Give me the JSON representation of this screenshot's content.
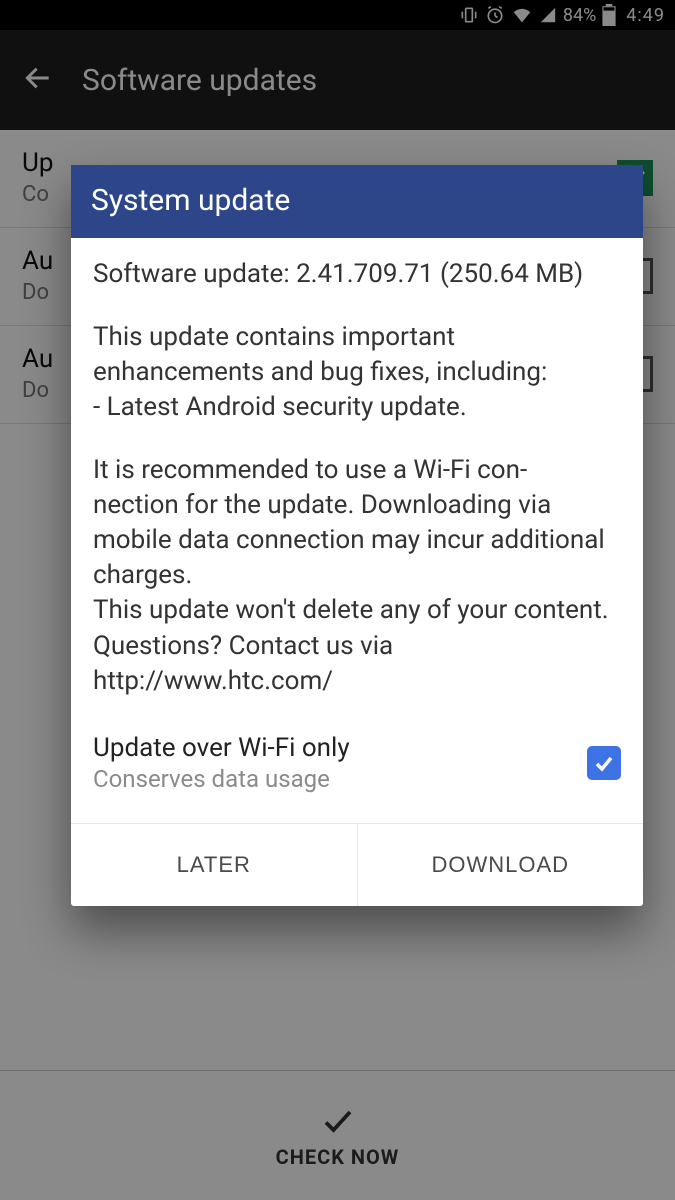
{
  "status": {
    "battery_pct": "84%",
    "time": "4:49"
  },
  "app_bar": {
    "title": "Software updates"
  },
  "bg": {
    "row1_primary": "Up",
    "row1_secondary": "Co",
    "row2_primary": "Au",
    "row2_secondary": "Do",
    "row3_primary": "Au",
    "row3_secondary": "Do",
    "check_now_label": "CHECK NOW"
  },
  "dialog": {
    "title": "System update",
    "version_line": "Software update: 2.41.709.71 (250.64 MB)",
    "para1": "This update contains important enhancements and bug fixes, including:\n- Latest Android security update.",
    "para2": "It is recommended to use a Wi-Fi con-\nnection for the update. Downloading via mobile data connection may incur additional charges.\nThis update won't delete any of your content. Questions? Contact us via http://www.htc.com/",
    "wifi_only_title": "Update over Wi-Fi only",
    "wifi_only_sub": "Conserves data usage",
    "wifi_only_checked": true,
    "button_later": "LATER",
    "button_download": "DOWNLOAD"
  }
}
